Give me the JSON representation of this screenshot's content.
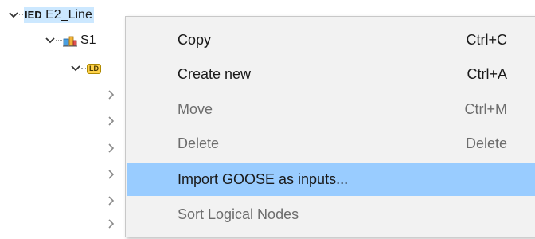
{
  "tree": {
    "root": {
      "tag": "IED",
      "label": "E2_Line",
      "expanded": true
    },
    "substation": {
      "label": "S1",
      "icon": "substation-icon",
      "expanded": true
    },
    "logical_device": {
      "badge": "LD",
      "expanded": true
    },
    "collapsed_children_count": 7
  },
  "context_menu": {
    "items": [
      {
        "label": "Copy",
        "accel": "Ctrl+C",
        "enabled": true,
        "highlighted": false
      },
      {
        "label": "Create new",
        "accel": "Ctrl+A",
        "enabled": true,
        "highlighted": false
      },
      {
        "label": "Move",
        "accel": "Ctrl+M",
        "enabled": false,
        "highlighted": false
      },
      {
        "label": "Delete",
        "accel": "Delete",
        "enabled": false,
        "highlighted": false
      },
      {
        "label": "Import GOOSE as inputs...",
        "accel": "",
        "enabled": true,
        "highlighted": true
      },
      {
        "label": "Sort Logical Nodes",
        "accel": "",
        "enabled": false,
        "highlighted": false
      }
    ]
  },
  "colors": {
    "selection": "#cce8ff",
    "menu_highlight": "#99ccff",
    "menu_background": "#f2f2f2",
    "ld_badge": "#ffd24a"
  }
}
